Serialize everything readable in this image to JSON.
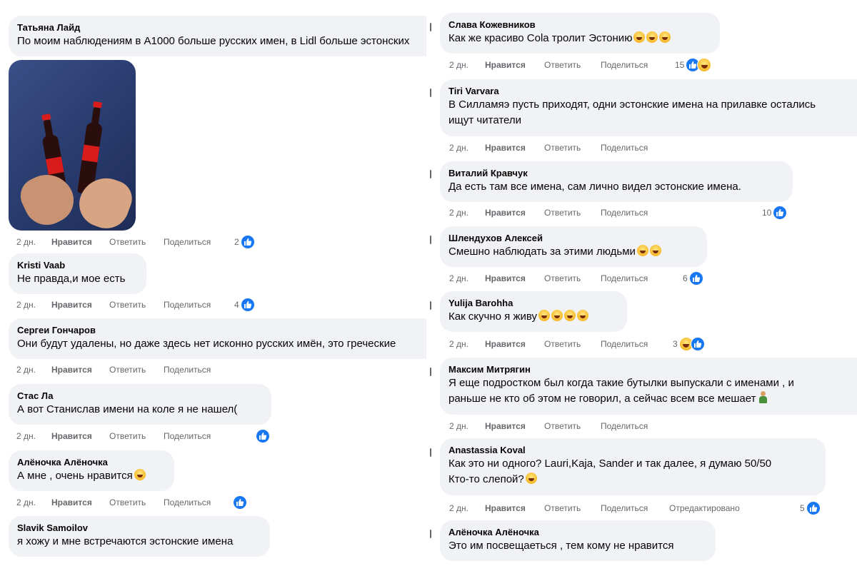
{
  "actions": {
    "time": "2 дн.",
    "like": "Нравится",
    "reply": "Ответить",
    "share": "Поделиться",
    "edited": "Отредактировано"
  },
  "left_comments": [
    {
      "author": "Татьяна Лайд",
      "text": "По моим наблюдениям в А1000 больше русских имен, в Lidl больше эстонских",
      "reactions": "2"
    },
    {
      "author": "Kristi Vaab",
      "text": "Не правда,и мое есть",
      "reactions": "4"
    },
    {
      "author": "Сергеи Гончаров",
      "text": "Они будут удалены, но даже здесь нет исконно русских имён, это греческие",
      "reactions": ""
    },
    {
      "author": "Стас Ла",
      "text": "А вот Станислав имени на коле я не нашел(",
      "reactions": ""
    },
    {
      "author": "Алёночка Алёночка",
      "text": "А мне , очень нравится",
      "reactions": ""
    },
    {
      "author": "Slavik Samoilov",
      "text": "я хожу и мне встречаются эстонские имена",
      "reactions": ""
    }
  ],
  "right_comments": [
    {
      "author": "Слава Кожевников",
      "text": "Как же красиво Cola тролит Эстонию",
      "reactions": "15"
    },
    {
      "author": "Tiri Varvara",
      "text": "В Силламяэ пусть приходят, одни эстонские имена на прилавке остались",
      "text2": "ищут читатели",
      "reactions": ""
    },
    {
      "author": "Виталий Кравчук",
      "text": "Да есть там все имена, сам лично видел эстонские имена.",
      "reactions": "10"
    },
    {
      "author": "Шлендухов Алексей",
      "text": "Смешно наблюдать за этими людьми",
      "reactions": "6"
    },
    {
      "author": "Yulija Barohha",
      "text": "Как скучно я живу",
      "reactions": "3"
    },
    {
      "author": "Максим Митрягин",
      "text": "Я еще подростком был когда такие бутылки выпускали с именами , и",
      "text2": "раньше не кто об этом не говорил, а сейчас всем все мешает",
      "reactions": ""
    },
    {
      "author": "Anastassia Koval",
      "text": "Как это ни одного? Lauri,Kaja, Sander и так далее, я думаю 50/50",
      "text2": "Кто-то слепой?",
      "reactions": "5"
    },
    {
      "author": "Алёночка Алёночка",
      "text": "Это им посвещаеться , тем кому не нравится",
      "reactions": ""
    }
  ],
  "icons": {
    "like": "like-icon",
    "haha": "haha-icon",
    "emoji": "laughing-emoji-icon"
  },
  "colors": {
    "bubble": "#f0f2f5",
    "like": "#1877f2",
    "meta": "#65676b"
  }
}
